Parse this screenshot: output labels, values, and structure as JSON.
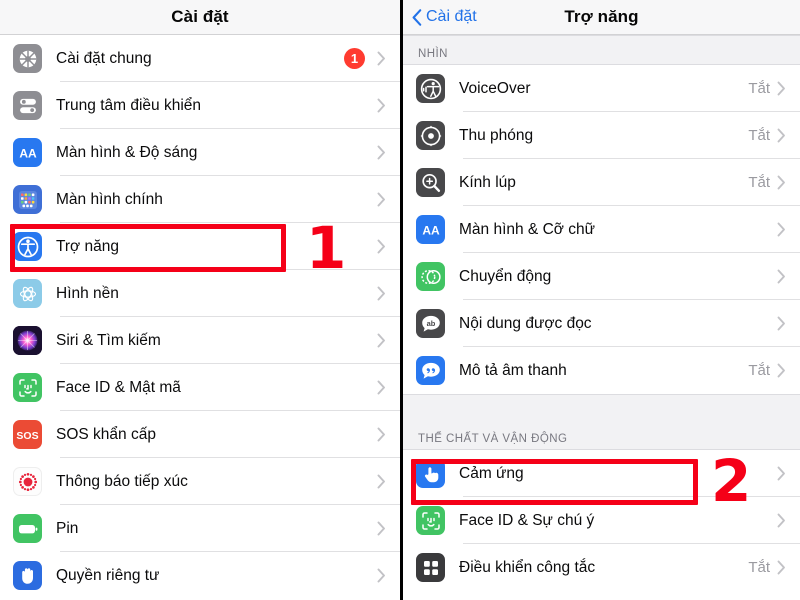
{
  "left_screen": {
    "nav": {
      "title": "Cài đặt"
    },
    "rows": [
      {
        "label": "Cài đặt chung",
        "icon": "gear-icon",
        "badge": "1",
        "value": "",
        "chevron": "›"
      },
      {
        "label": "Trung tâm điều khiển",
        "icon": "control-center-icon",
        "badge": "",
        "value": "",
        "chevron": "›"
      },
      {
        "label": "Màn hình & Độ sáng",
        "icon": "display-brightness-icon",
        "badge": "",
        "value": "",
        "chevron": "›"
      },
      {
        "label": "Màn hình chính",
        "icon": "home-screen-icon",
        "badge": "",
        "value": "",
        "chevron": "›"
      },
      {
        "label": "Trợ năng",
        "icon": "accessibility-icon",
        "badge": "",
        "value": "",
        "chevron": "›"
      },
      {
        "label": "Hình nền",
        "icon": "wallpaper-icon",
        "badge": "",
        "value": "",
        "chevron": "›"
      },
      {
        "label": "Siri & Tìm kiếm",
        "icon": "siri-icon",
        "badge": "",
        "value": "",
        "chevron": "›"
      },
      {
        "label": "Face ID & Mật mã",
        "icon": "face-id-icon",
        "badge": "",
        "value": "",
        "chevron": "›"
      },
      {
        "label": "SOS khẩn cấp",
        "icon": "sos-icon",
        "badge": "",
        "value": "",
        "chevron": "›"
      },
      {
        "label": "Thông báo tiếp xúc",
        "icon": "exposure-notification-icon",
        "badge": "",
        "value": "",
        "chevron": "›"
      },
      {
        "label": "Pin",
        "icon": "battery-icon",
        "badge": "",
        "value": "",
        "chevron": "›"
      },
      {
        "label": "Quyền riêng tư",
        "icon": "privacy-hand-icon",
        "badge": "",
        "value": "",
        "chevron": "›"
      }
    ],
    "step_marker": "1"
  },
  "right_screen": {
    "nav": {
      "back_label": "Cài đặt",
      "title": "Trợ năng"
    },
    "sections": [
      {
        "header": "NHÌN",
        "rows": [
          {
            "label": "VoiceOver",
            "icon": "voiceover-icon",
            "value": "Tắt",
            "chevron": "›"
          },
          {
            "label": "Thu phóng",
            "icon": "zoom-icon",
            "value": "Tắt",
            "chevron": "›"
          },
          {
            "label": "Kính lúp",
            "icon": "magnifier-icon",
            "value": "Tắt",
            "chevron": "›"
          },
          {
            "label": "Màn hình & Cỡ chữ",
            "icon": "display-text-icon",
            "value": "",
            "chevron": "›"
          },
          {
            "label": "Chuyển động",
            "icon": "motion-icon",
            "value": "",
            "chevron": "›"
          },
          {
            "label": "Nội dung được đọc",
            "icon": "spoken-content-icon",
            "value": "",
            "chevron": "›"
          },
          {
            "label": "Mô tả âm thanh",
            "icon": "audio-description-icon",
            "value": "Tắt",
            "chevron": "›"
          }
        ]
      },
      {
        "header": "THỂ CHẤT VÀ VẬN ĐỘNG",
        "rows": [
          {
            "label": "Cảm ứng",
            "icon": "touch-icon",
            "value": "",
            "chevron": "›"
          },
          {
            "label": "Face ID & Sự chú ý",
            "icon": "face-id-icon",
            "value": "",
            "chevron": "›"
          },
          {
            "label": "Điều khiển công tắc",
            "icon": "switch-control-icon",
            "value": "Tắt",
            "chevron": "›"
          }
        ]
      }
    ],
    "step_marker": "2"
  },
  "colors": {
    "highlight": "#f50018",
    "badge": "#ff3b30",
    "link": "#2272e8",
    "value_text": "#9a9aa0"
  }
}
